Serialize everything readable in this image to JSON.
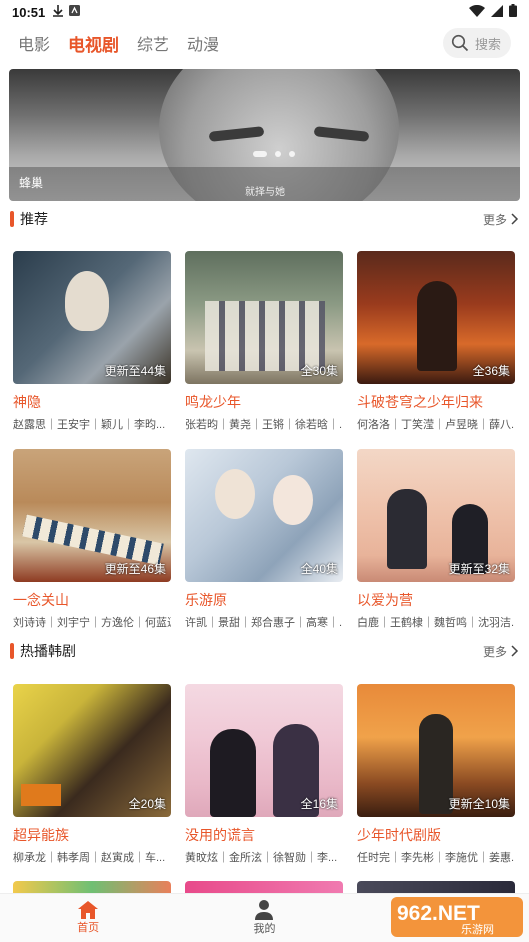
{
  "status": {
    "time": "10:51"
  },
  "nav": {
    "tabs": [
      {
        "label": "电影"
      },
      {
        "label": "电视剧"
      },
      {
        "label": "综艺"
      },
      {
        "label": "动漫"
      }
    ],
    "active_index": 1,
    "search_placeholder": "搜索"
  },
  "banner": {
    "caption": "蜂巢",
    "overlay_text": "就择与她"
  },
  "sections": [
    {
      "title": "推荐",
      "more_label": "更多",
      "items": [
        {
          "name": "神隐",
          "badge": "更新至44集",
          "cast": "赵露思｜王安宇｜颖儿｜李昀..."
        },
        {
          "name": "鸣龙少年",
          "badge": "全30集",
          "cast": "张若昀｜黄尧｜王锵｜徐若晗｜..."
        },
        {
          "name": "斗破苍穹之少年归来",
          "badge": "全36集",
          "cast": "何洛洛｜丁笑滢｜卢昱晓｜薛八..."
        },
        {
          "name": "一念关山",
          "badge": "更新至46集",
          "cast": "刘诗诗｜刘宇宁｜方逸伦｜何蓝逗..."
        },
        {
          "name": "乐游原",
          "badge": "全40集",
          "cast": "许凯｜景甜｜郑合惠子｜高寒｜..."
        },
        {
          "name": "以爱为营",
          "badge": "更新至32集",
          "cast": "白鹿｜王鹤棣｜魏哲鸣｜沈羽洁..."
        }
      ]
    },
    {
      "title": "热播韩剧",
      "more_label": "更多",
      "items": [
        {
          "name": "超异能族",
          "badge": "全20集",
          "cast": "柳承龙｜韩孝周｜赵寅成｜车..."
        },
        {
          "name": "没用的谎言",
          "badge": "全16集",
          "cast": "黄旼炫｜金所泫｜徐智勋｜李..."
        },
        {
          "name": "少年时代剧版",
          "badge": "更新全10集",
          "cast": "任时完｜李先彬｜李施优｜姜惠..."
        }
      ]
    }
  ],
  "bottom_tabs": [
    {
      "label": "首页"
    },
    {
      "label": "我的"
    }
  ],
  "watermark": {
    "text": "962.NET",
    "sub": "乐游网"
  },
  "colors": {
    "accent": "#e8562a"
  }
}
